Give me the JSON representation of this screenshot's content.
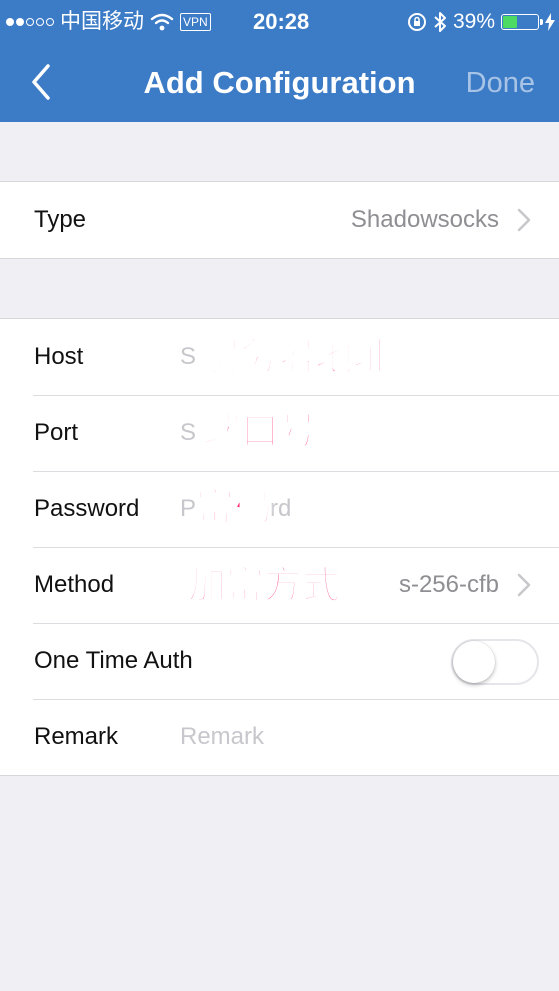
{
  "status_bar": {
    "carrier": "中国移动",
    "vpn": "VPN",
    "time": "20:28",
    "battery_percent": "39%",
    "battery_level": 0.39,
    "icons": [
      "signal-dots-icon",
      "wifi-icon",
      "vpn-icon",
      "rotation-lock-icon",
      "bluetooth-icon",
      "battery-icon",
      "charging-icon"
    ]
  },
  "nav": {
    "title": "Add Configuration",
    "done_label": "Done",
    "back_icon": "chevron-left-icon"
  },
  "type_row": {
    "label": "Type",
    "value": "Shadowsocks"
  },
  "form": {
    "host": {
      "label": "Host",
      "placeholder_visible": "S"
    },
    "port": {
      "label": "Port",
      "placeholder_visible": "S"
    },
    "password": {
      "label": "Password",
      "placeholder_left": "P",
      "placeholder_right": "rd"
    },
    "method": {
      "label": "Method",
      "value_visible": "s-256-cfb"
    },
    "one_time_auth": {
      "label": "One Time Auth",
      "enabled": false
    },
    "remark": {
      "label": "Remark",
      "placeholder": "Remark"
    }
  },
  "annotations": {
    "host": "服务器地址",
    "port": "端口号",
    "password": "密码",
    "method": "加密方式"
  },
  "colors": {
    "nav_background": "#3c7bc6",
    "annotation": "#ff2d6f",
    "page_background": "#efeff4"
  }
}
